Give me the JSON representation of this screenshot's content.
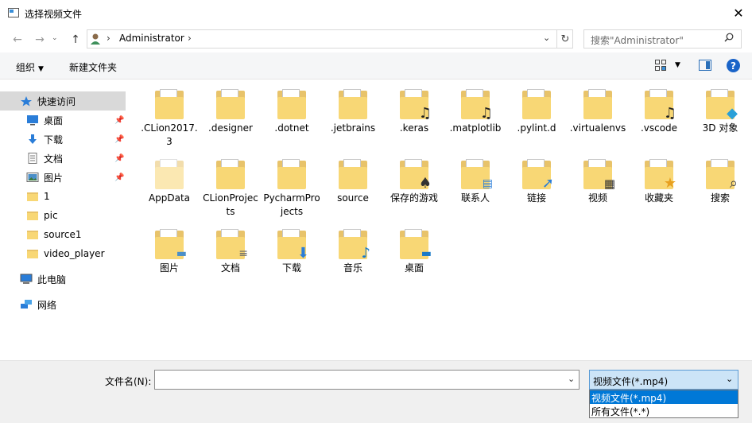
{
  "window": {
    "title": "选择视频文件",
    "close_label": "✕"
  },
  "address": {
    "path_item": "Administrator",
    "search_placeholder": "搜索\"Administrator\""
  },
  "toolbar": {
    "organize": "组织",
    "new_folder": "新建文件夹"
  },
  "sidebar": {
    "items": [
      {
        "label": "快速访问",
        "icon": "star-icon"
      },
      {
        "label": "桌面",
        "icon": "desktop-icon",
        "pinned": true
      },
      {
        "label": "下载",
        "icon": "download-icon",
        "pinned": true
      },
      {
        "label": "文档",
        "icon": "document-icon",
        "pinned": true
      },
      {
        "label": "图片",
        "icon": "picture-icon",
        "pinned": true
      },
      {
        "label": "1",
        "icon": "folder-icon"
      },
      {
        "label": "pic",
        "icon": "folder-icon"
      },
      {
        "label": "source1",
        "icon": "folder-icon"
      },
      {
        "label": "video_player",
        "icon": "folder-icon"
      },
      {
        "label": "此电脑",
        "icon": "computer-icon"
      },
      {
        "label": "网络",
        "icon": "network-icon"
      }
    ]
  },
  "files": [
    {
      "name": ".CLion2017.3",
      "icon": "folder-icon"
    },
    {
      "name": ".designer",
      "icon": "folder-icon"
    },
    {
      "name": ".dotnet",
      "icon": "folder-icon"
    },
    {
      "name": ".jetbrains",
      "icon": "folder-icon"
    },
    {
      "name": ".keras",
      "icon": "music-folder-icon"
    },
    {
      "name": ".matplotlib",
      "icon": "music-folder-icon"
    },
    {
      "name": ".pylint.d",
      "icon": "folder-icon"
    },
    {
      "name": ".virtualenvs",
      "icon": "folder-icon"
    },
    {
      "name": ".vscode",
      "icon": "music-folder-icon"
    },
    {
      "name": "3D 对象",
      "icon": "3d-objects-icon"
    },
    {
      "name": "AppData",
      "icon": "folder-icon"
    },
    {
      "name": "CLionProjects",
      "icon": "folder-icon"
    },
    {
      "name": "PycharmProjects",
      "icon": "folder-icon"
    },
    {
      "name": "source",
      "icon": "folder-icon"
    },
    {
      "name": "保存的游戏",
      "icon": "saved-games-icon"
    },
    {
      "name": "联系人",
      "icon": "contacts-icon"
    },
    {
      "name": "链接",
      "icon": "links-icon"
    },
    {
      "name": "视频",
      "icon": "videos-icon"
    },
    {
      "name": "收藏夹",
      "icon": "favorites-icon"
    },
    {
      "name": "搜索",
      "icon": "searches-icon"
    },
    {
      "name": "图片",
      "icon": "pictures-folder-icon"
    },
    {
      "name": "文档",
      "icon": "documents-folder-icon"
    },
    {
      "name": "下载",
      "icon": "downloads-folder-icon"
    },
    {
      "name": "音乐",
      "icon": "music-icon"
    },
    {
      "name": "桌面",
      "icon": "desktop-folder-icon"
    }
  ],
  "footer": {
    "filename_label": "文件名(N):",
    "filename_value": "",
    "filetype_selected": "视频文件(*.mp4)",
    "filetype_options": [
      "视频文件(*.mp4)",
      "所有文件(*.*)"
    ]
  }
}
